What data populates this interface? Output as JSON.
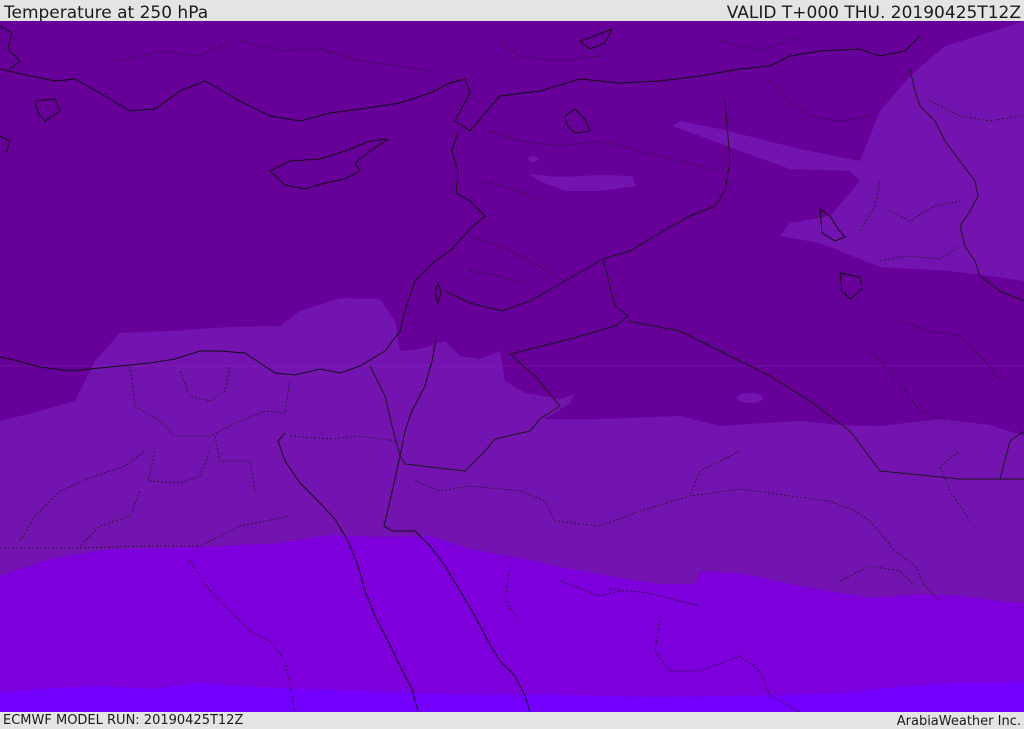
{
  "header": {
    "title": "Temperature at 250 hPa",
    "valid": "VALID T+000 THU. 20190425T12Z"
  },
  "footer": {
    "model_run": "ECMWF MODEL RUN: 20190425T12Z",
    "credit": "ArabiaWeather Inc."
  },
  "map": {
    "colors": {
      "band_coldest": "#660099",
      "band_cold": "#7414b0",
      "band_mid": "#7d00dc",
      "band_warm": "#7300ff",
      "coastline": "#111111",
      "border": "#1a1a1a"
    }
  }
}
